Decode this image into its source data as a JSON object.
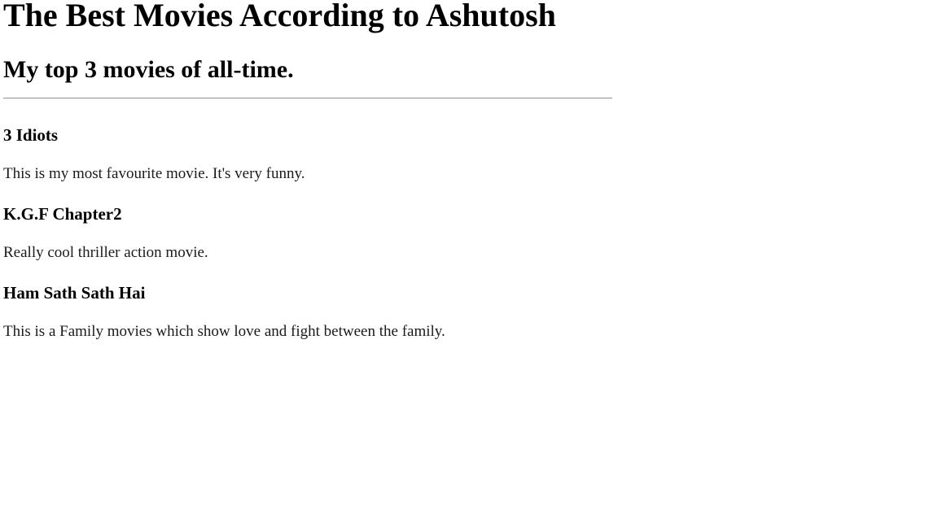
{
  "page": {
    "title": "The Best Movies According to Ashutosh",
    "subtitle": "My top 3 movies of all-time."
  },
  "movies": [
    {
      "title": "3 Idiots",
      "description": "This is my most favourite movie. It's very funny."
    },
    {
      "title": "K.G.F Chapter2",
      "description": "Really cool thriller action movie."
    },
    {
      "title": "Ham Sath Sath Hai",
      "description": "This is a Family movies which show love and fight between the family."
    }
  ]
}
